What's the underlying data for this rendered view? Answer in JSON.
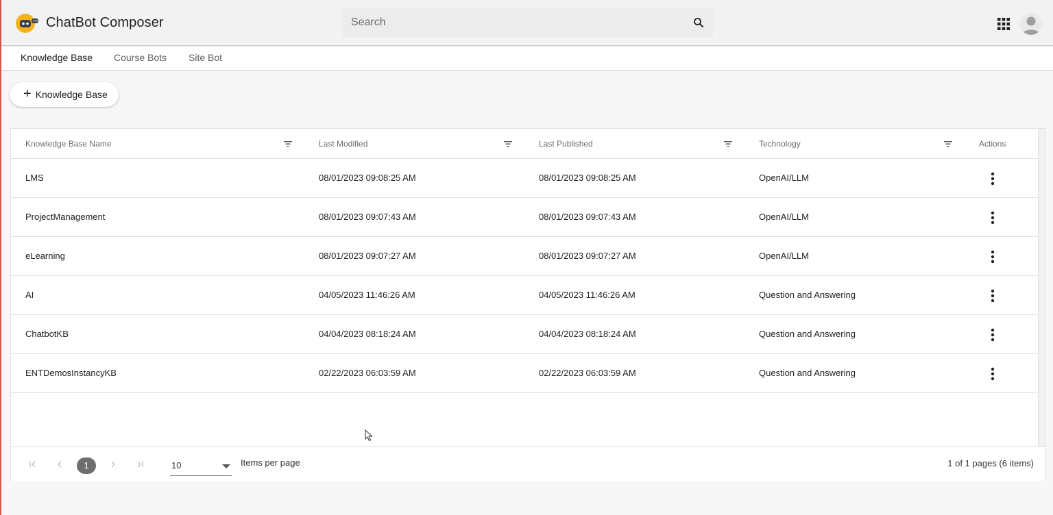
{
  "app": {
    "title": "ChatBot Composer",
    "brand_color": "#f5b21a"
  },
  "search": {
    "placeholder": "Search"
  },
  "icons": {
    "search": "search-icon",
    "apps": "apps-grid-icon",
    "avatar": "user-avatar-icon",
    "filter": "filter-icon",
    "actions": "more-vert-icon"
  },
  "tabs": [
    {
      "label": "Knowledge Base",
      "active": true
    },
    {
      "label": "Course Bots",
      "active": false
    },
    {
      "label": "Site Bot",
      "active": false
    }
  ],
  "add_button": {
    "label": "Knowledge Base"
  },
  "table": {
    "columns": [
      "Knowledge Base Name",
      "Last Modified",
      "Last Published",
      "Technology",
      "Actions"
    ],
    "rows": [
      {
        "name": "LMS",
        "modified": "08/01/2023 09:08:25 AM",
        "published": "08/01/2023 09:08:25 AM",
        "technology": "OpenAI/LLM"
      },
      {
        "name": "ProjectManagement",
        "modified": "08/01/2023 09:07:43 AM",
        "published": "08/01/2023 09:07:43 AM",
        "technology": "OpenAI/LLM"
      },
      {
        "name": "eLearning",
        "modified": "08/01/2023 09:07:27 AM",
        "published": "08/01/2023 09:07:27 AM",
        "technology": "OpenAI/LLM"
      },
      {
        "name": "AI",
        "modified": "04/05/2023 11:46:26 AM",
        "published": "04/05/2023 11:46:26 AM",
        "technology": "Question and Answering"
      },
      {
        "name": "ChatbotKB",
        "modified": "04/04/2023 08:18:24 AM",
        "published": "04/04/2023 08:18:24 AM",
        "technology": "Question and Answering"
      },
      {
        "name": "ENTDemosInstancyKB",
        "modified": "02/22/2023 06:03:59 AM",
        "published": "02/22/2023 06:03:59 AM",
        "technology": "Question and Answering"
      }
    ]
  },
  "pager": {
    "current_page": "1",
    "page_size": "10",
    "items_per_page_label": "Items per page",
    "info": "1 of 1 pages (6 items)"
  }
}
